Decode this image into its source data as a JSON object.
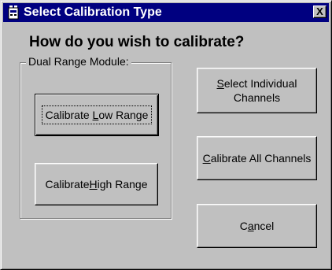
{
  "window": {
    "title": "Select Calibration Type",
    "close_label": "X"
  },
  "prompt": {
    "question": "How do you wish to calibrate?"
  },
  "group": {
    "legend": "Dual Range Module:"
  },
  "buttons": {
    "calibrate_low": {
      "pre": "Calibrate ",
      "accel": "L",
      "post": "ow Range"
    },
    "calibrate_high": {
      "pre": "Calibrate ",
      "accel": "H",
      "post": "igh Range"
    },
    "select_individual": {
      "line1_accel": "S",
      "line1_post": "elect Individual",
      "line2": "Channels"
    },
    "calibrate_all": {
      "accel": "C",
      "post": "alibrate All Channels"
    },
    "cancel": {
      "pre": "C",
      "accel": "a",
      "post": "ncel"
    }
  },
  "colors": {
    "titlebar": "#000080",
    "face": "#c0c0c0"
  }
}
